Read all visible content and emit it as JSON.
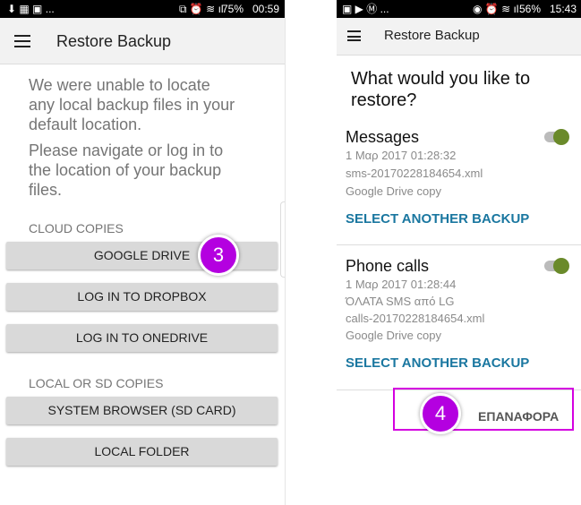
{
  "left": {
    "status": {
      "left_icons": "⬇ ▦ ▣ ...",
      "right": "75%",
      "time": "00:59"
    },
    "appbar": {
      "title": "Restore Backup"
    },
    "message1": [
      "We were unable to locate",
      "any local backup files in your",
      "default location."
    ],
    "message2": [
      "Please navigate or log in to",
      "the location of your backup",
      "files."
    ],
    "cloud_header": "CLOUD COPIES",
    "cloud_buttons": [
      "GOOGLE DRIVE",
      "LOG IN TO DROPBOX",
      "LOG IN TO ONEDRIVE"
    ],
    "local_header": "LOCAL OR SD COPIES",
    "local_buttons": [
      "SYSTEM BROWSER (SD CARD)",
      "LOCAL FOLDER"
    ],
    "step_badge": "3"
  },
  "right": {
    "status": {
      "left_icons": "▣ ▶ Ⓜ ...",
      "right": "56%",
      "time": "15:43"
    },
    "appbar": {
      "title": "Restore Backup"
    },
    "question": [
      "What would you like to",
      "restore?"
    ],
    "items": [
      {
        "title": "Messages",
        "details": [
          "1 Μαρ 2017 01:28:32",
          "sms-20170228184654.xml",
          "Google Drive copy"
        ],
        "select": "SELECT ANOTHER BACKUP",
        "enabled": true
      },
      {
        "title": "Phone calls",
        "details": [
          "1 Μαρ 2017 01:28:44",
          "ΌΛΑΤΑ SMS από LG",
          "calls-20170228184654.xml",
          "Google Drive copy"
        ],
        "select": "SELECT ANOTHER BACKUP",
        "enabled": true
      }
    ],
    "restore_button": "ΕΠΑΝΑΦΟΡΑ",
    "step_badge": "4",
    "highlight_color": "#d400e0"
  },
  "colors": {
    "accent": "#1a77a0",
    "toggle": "#6a8a2a",
    "badge": "#b400e0"
  }
}
